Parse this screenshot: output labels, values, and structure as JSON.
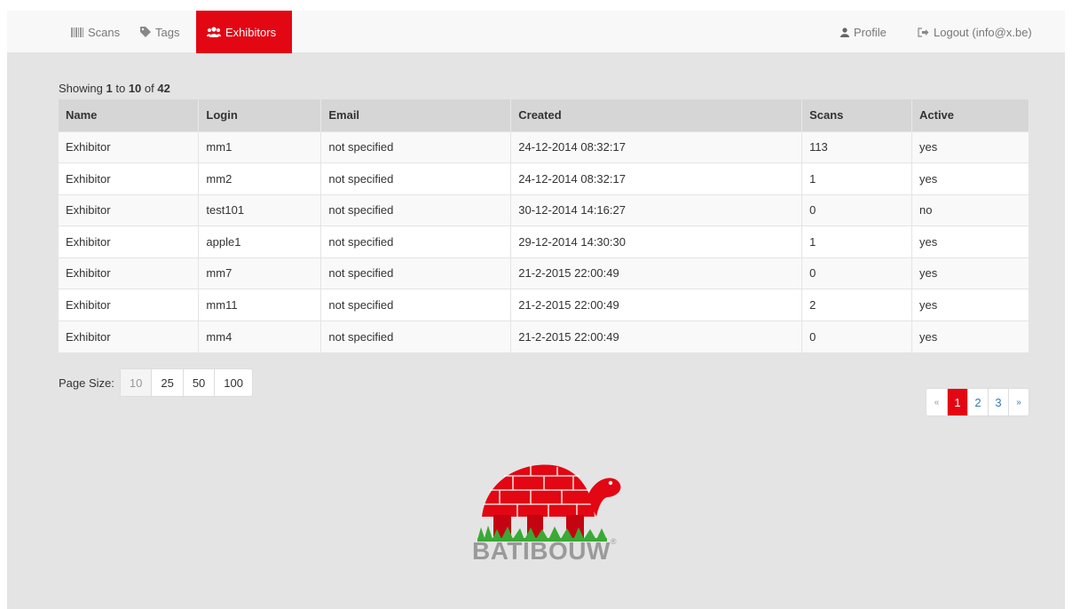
{
  "nav": {
    "scans": "Scans",
    "tags": "Tags",
    "exhibitors": "Exhibitors",
    "profile": "Profile",
    "logout": "Logout (info@x.be)"
  },
  "showing": {
    "prefix": "Showing",
    "from": "1",
    "to_word": "to",
    "to": "10",
    "of_word": "of",
    "total": "42"
  },
  "table": {
    "headers": [
      "Name",
      "Login",
      "Email",
      "Created",
      "Scans",
      "Active"
    ],
    "rows": [
      [
        "Exhibitor",
        "mm1",
        "not specified",
        "24-12-2014 08:32:17",
        "113",
        "yes"
      ],
      [
        "Exhibitor",
        "mm2",
        "not specified",
        "24-12-2014 08:32:17",
        "1",
        "yes"
      ],
      [
        "Exhibitor",
        "test101",
        "not specified",
        "30-12-2014 14:16:27",
        "0",
        "no"
      ],
      [
        "Exhibitor",
        "apple1",
        "not specified",
        "29-12-2014 14:30:30",
        "1",
        "yes"
      ],
      [
        "Exhibitor",
        "mm7",
        "not specified",
        "21-2-2015 22:00:49",
        "0",
        "yes"
      ],
      [
        "Exhibitor",
        "mm11",
        "not specified",
        "21-2-2015 22:00:49",
        "2",
        "yes"
      ],
      [
        "Exhibitor",
        "mm4",
        "not specified",
        "21-2-2015 22:00:49",
        "0",
        "yes"
      ]
    ]
  },
  "page_size": {
    "label": "Page Size:",
    "options": [
      "10",
      "25",
      "50",
      "100"
    ]
  },
  "pagination": {
    "prev": "«",
    "pages": [
      "1",
      "2",
      "3"
    ],
    "next": "»"
  },
  "logo": {
    "text": "BATIBOUW",
    "mark": "®"
  },
  "colors": {
    "accent": "#e30613",
    "link": "#337ab7"
  }
}
